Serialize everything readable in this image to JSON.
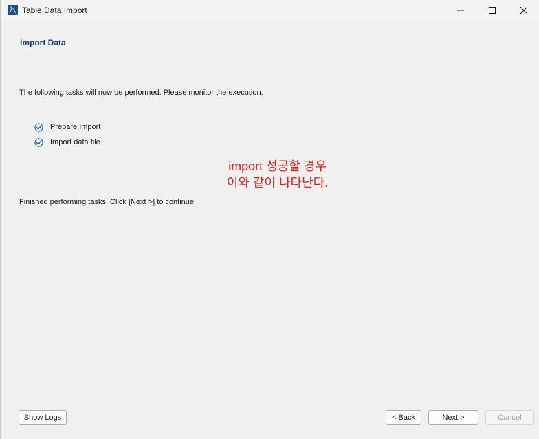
{
  "window": {
    "title": "Table Data Import",
    "app_icon": "mysql-workbench-icon"
  },
  "page": {
    "heading": "Import Data",
    "description": "The following tasks will now be performed. Please monitor the execution.",
    "tasks": [
      {
        "label": "Prepare Import",
        "status": "done"
      },
      {
        "label": "Import data file",
        "status": "done"
      }
    ],
    "annotation_line1": "import 성공할 경우",
    "annotation_line2": "이와 같이 나타난다.",
    "finished_text": "Finished performing tasks. Click [Next >] to continue."
  },
  "footer": {
    "show_logs": "Show Logs",
    "back": "< Back",
    "next": "Next >",
    "cancel": "Cancel"
  },
  "colors": {
    "heading": "#1c3d7a",
    "annotation": "#e0201a",
    "check": "#1f5fa8"
  }
}
